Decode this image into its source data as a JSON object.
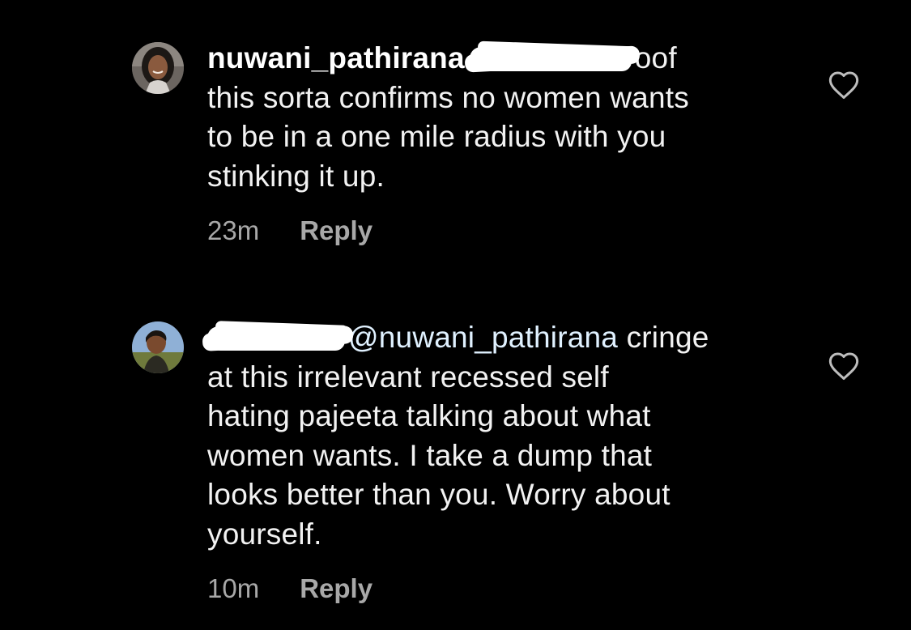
{
  "comments": [
    {
      "username": "nuwani_pathirana",
      "mention_redacted": true,
      "mention_tail": "oof",
      "lines": [
        "this sorta confirms no women wants",
        "to be in a one mile radius with you",
        "stinking it up."
      ],
      "time": "23m",
      "reply_label": "Reply",
      "avatar_icon": "profile-photo-woman",
      "like_icon": "heart-outline-icon"
    },
    {
      "username_redacted": true,
      "mention": "@nuwani_pathirana",
      "first_line_tail": "cringe",
      "lines": [
        "at this irrelevant recessed self",
        "hating pajeeta talking about what",
        "women wants. I take a dump that",
        "looks better than you. Worry about",
        "yourself."
      ],
      "time": "10m",
      "reply_label": "Reply",
      "avatar_icon": "profile-photo-man",
      "like_icon": "heart-outline-icon"
    }
  ],
  "colors": {
    "background": "#000000",
    "text": "#f2f2f2",
    "meta": "#a8a8a8",
    "redaction": "#ffffff"
  }
}
